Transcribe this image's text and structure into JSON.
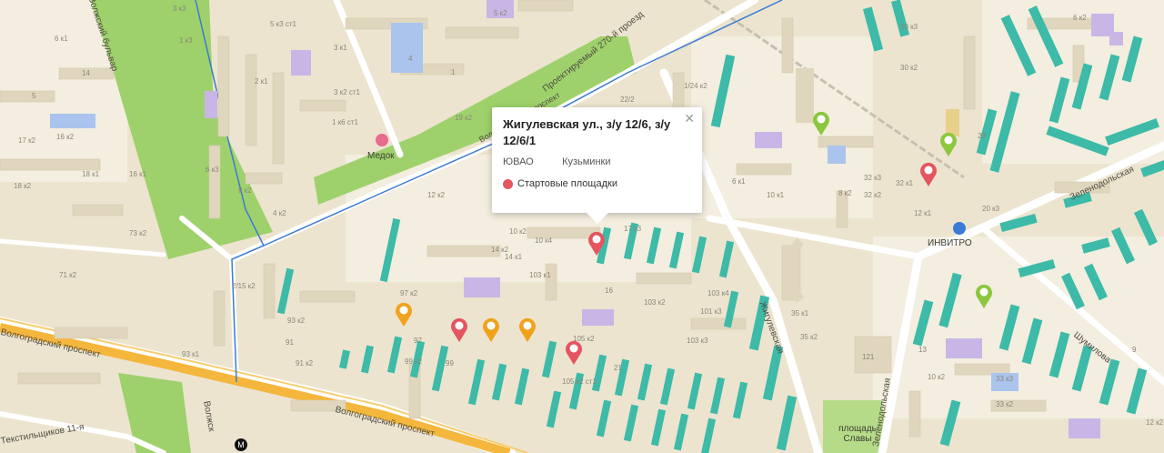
{
  "popup": {
    "title": "Жигулевская ул., з/у 12/6, з/у 12/6/1",
    "district": "ЮВАО",
    "area": "Кузьминки",
    "category": "Стартовые площадки",
    "category_color": "#e45560",
    "close_icon": "close-icon"
  },
  "streets": [
    "Волгоградский проспект",
    "Волгоградский проспект",
    "Проектируемый 270-й проезд",
    "Жигулевская",
    "Зеленодольская",
    "Зеленодольская",
    "Шумилова",
    "Волжский бульвар",
    "Волгоградский проспект",
    "Текстильщиков 11-я",
    "Волжск"
  ],
  "places": [
    {
      "label": "Медок",
      "icon": "shop-icon"
    },
    {
      "label": "ИНВИТРО",
      "icon": "lab-icon"
    },
    {
      "label": "площадь Славы",
      "icon": "square-icon"
    }
  ],
  "house_numbers": [
    "5 к3 ст1",
    "3 к3",
    "1 к3",
    "5 к2",
    "6 к1",
    "14",
    "5",
    "17 к2",
    "4",
    "1",
    "16 к2",
    "18 к1",
    "16 к1",
    "18 к2",
    "73 к2",
    "71 к2",
    "3 к1",
    "2 к1",
    "3 к2 ст1",
    "1 к6 ст1",
    "6 к3",
    "4 к2",
    "12 к2",
    "10 к2",
    "14 к2",
    "10 к4",
    "103 к1",
    "103 к2",
    "105 к2",
    "105 к2 ст1",
    "103 к3",
    "101 к3",
    "103 к4",
    "99 к2",
    "97 к2",
    "93 к2",
    "99",
    "97",
    "91 к2",
    "91",
    "93 к1",
    "17 к3",
    "14 к1",
    "16",
    "21",
    "32 к3",
    "32 к2",
    "32 к1",
    "35 к2",
    "35 к1",
    "121",
    "28",
    "33 к3",
    "33 к2",
    "30 к3",
    "30 к2",
    "6 к1",
    "8 к2",
    "2/15 к2",
    "1/24 к2",
    "22/2",
    "8 к2",
    "19 к2",
    "20 к3",
    "6 к2",
    "9",
    "12 к1",
    "10 к1",
    "13",
    "10 к2",
    "12 к2"
  ],
  "markers": [
    {
      "name": "selected-site-marker",
      "color": "#e45560",
      "category": "Стартовые площадки"
    },
    {
      "name": "site-marker",
      "color": "#e45560",
      "category": "Стартовые площадки"
    },
    {
      "name": "site-marker",
      "color": "#e45560",
      "category": "Стартовые площадки"
    },
    {
      "name": "site-marker",
      "color": "#e45560",
      "category": "Стартовые площадки"
    },
    {
      "name": "orange-marker",
      "color": "#f0a21c"
    },
    {
      "name": "orange-marker",
      "color": "#f0a21c"
    },
    {
      "name": "orange-marker",
      "color": "#f0a21c"
    },
    {
      "name": "orange-marker",
      "color": "#f0a21c"
    },
    {
      "name": "green-marker",
      "color": "#8dc63f"
    },
    {
      "name": "green-marker",
      "color": "#8dc63f"
    },
    {
      "name": "green-marker",
      "color": "#8dc63f"
    }
  ],
  "metro": {
    "label": "М",
    "icon": "metro-icon"
  },
  "colors": {
    "background": "#ece4cf",
    "park": "#9ed16b",
    "avenue": "#f4b63c",
    "teal_building": "#3dbaa8",
    "purple_building": "#c9b6e6",
    "blue_building": "#aac4ee",
    "route_line": "#3a7bd5"
  }
}
